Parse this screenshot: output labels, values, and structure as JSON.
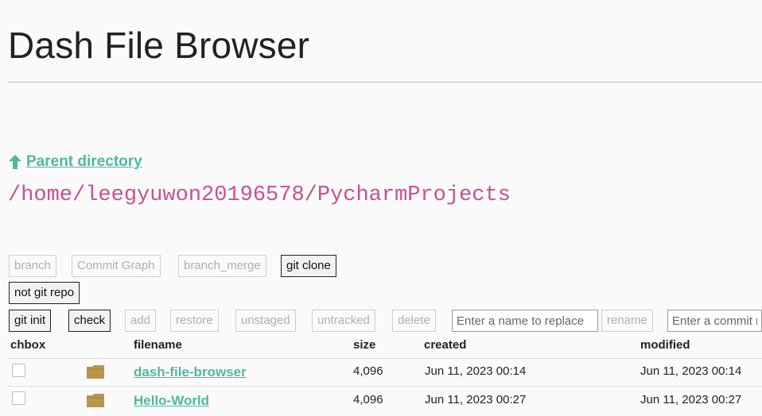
{
  "app": {
    "title": "Dash File Browser"
  },
  "nav": {
    "parent_label": "Parent directory",
    "current_path": "/home/leegyuwon20196578/PycharmProjects"
  },
  "toolbar": {
    "row1": {
      "branch": "branch",
      "commit_graph": "Commit Graph",
      "branch_merge": "branch_merge",
      "git_clone": "git clone"
    },
    "status": "not git repo",
    "row3": {
      "git_init": "git init",
      "check": "check",
      "add": "add",
      "restore": "restore",
      "unstaged": "unstaged",
      "untracked": "untracked",
      "delete": "delete",
      "rename_placeholder": "Enter a name to replace",
      "rename": "rename",
      "commit_placeholder": "Enter a commit message"
    }
  },
  "table": {
    "headers": {
      "chbox": "chbox",
      "filename": "filename",
      "size": "size",
      "created": "created",
      "modified": "modified"
    },
    "rows": [
      {
        "filename": "dash-file-browser",
        "size": "4,096",
        "created": "Jun 11, 2023 00:14",
        "modified": "Jun 11, 2023 00:14",
        "checked": false,
        "icon": "folder-icon"
      },
      {
        "filename": "Hello-World",
        "size": "4,096",
        "created": "Jun 11, 2023 00:27",
        "modified": "Jun 11, 2023 00:27",
        "checked": false,
        "icon": "folder-icon"
      }
    ]
  },
  "colors": {
    "link": "#4fb8a0",
    "path": "#cc4f8f",
    "folder": "#b8964f"
  }
}
